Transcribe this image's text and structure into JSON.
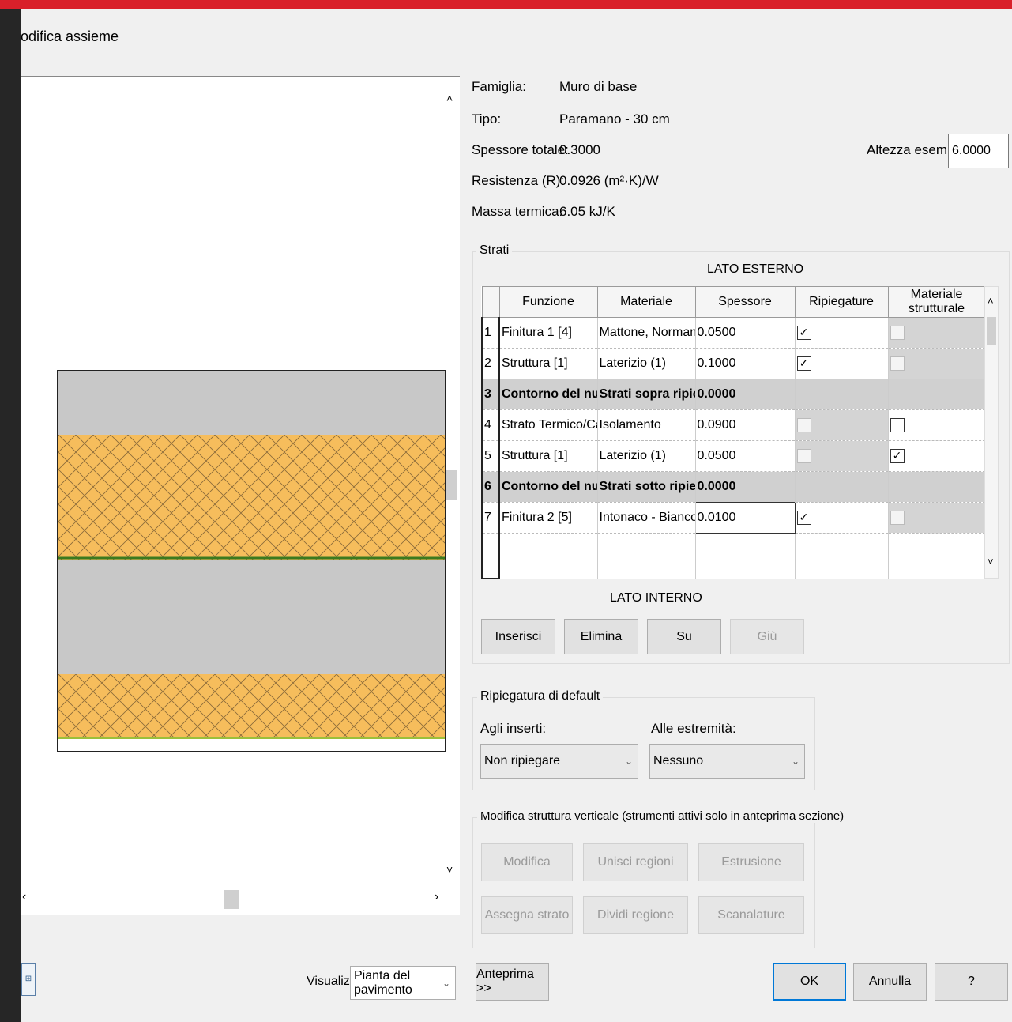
{
  "window": {
    "title": "odifica assieme"
  },
  "info": {
    "famiglia_label": "Famiglia:",
    "famiglia_value": "Muro di base",
    "tipo_label": "Tipo:",
    "tipo_value": "Paramano - 30 cm",
    "spessore_label": "Spessore totale:",
    "spessore_value": "0.3000",
    "resistenza_label": "Resistenza (R):",
    "resistenza_value": "0.0926 (m²·K)/W",
    "massa_label": "Massa termica:",
    "massa_value": "6.05 kJ/K",
    "altezza_label": "Altezza esempio:",
    "altezza_value": "6.0000"
  },
  "strati": {
    "group_label": "Strati",
    "lato_esterno": "LATO ESTERNO",
    "lato_interno": "LATO INTERNO",
    "columns": [
      "Funzione",
      "Materiale",
      "Spessore",
      "Ripiegature",
      "Materiale strutturale"
    ],
    "rows": [
      {
        "n": "1",
        "funzione": "Finitura 1 [4]",
        "materiale": "Mattone, Norman",
        "spessore": "0.0500",
        "rip": "checked",
        "strut": "disabled"
      },
      {
        "n": "2",
        "funzione": "Struttura [1]",
        "materiale": "Laterizio (1)",
        "spessore": "0.1000",
        "rip": "checked",
        "strut": "disabled"
      },
      {
        "n": "3",
        "funzione": "Contorno del nucleo",
        "materiale": "Strati sopra ripiegat",
        "spessore": "0.0000",
        "core": true
      },
      {
        "n": "4",
        "funzione": "Strato Termico/Came",
        "materiale": "Isolamento",
        "spessore": "0.0900",
        "rip": "disabled",
        "strut": "unchecked"
      },
      {
        "n": "5",
        "funzione": "Struttura [1]",
        "materiale": "Laterizio (1)",
        "spessore": "0.0500",
        "rip": "disabled",
        "strut": "checked"
      },
      {
        "n": "6",
        "funzione": "Contorno del nucleo",
        "materiale": "Strati sotto ripiegat",
        "spessore": "0.0000",
        "core": true
      },
      {
        "n": "7",
        "funzione": "Finitura 2 [5]",
        "materiale": "Intonaco - Bianco",
        "spessore": "0.0100",
        "rip": "checked",
        "strut": "disabled"
      }
    ],
    "buttons": {
      "inserisci": "Inserisci",
      "elimina": "Elimina",
      "su": "Su",
      "giu": "Giù"
    }
  },
  "ripiegatura": {
    "group_label": "Ripiegatura di default",
    "inserti_label": "Agli inserti:",
    "inserti_value": "Non ripiegare",
    "estremita_label": "Alle estremità:",
    "estremita_value": "Nessuno"
  },
  "verticale": {
    "group_label": "Modifica struttura verticale (strumenti attivi solo in anteprima sezione)",
    "modifica": "Modifica",
    "unisci": "Unisci regioni",
    "estrusione": "Estrusione",
    "assegna": "Assegna strato",
    "dividi": "Dividi regione",
    "scanalature": "Scanalature"
  },
  "footer": {
    "visualizza_label": "Visualizza:",
    "visualizza_value": "Pianta del pavimento",
    "anteprima": "Anteprima >>",
    "ok": "OK",
    "annulla": "Annulla",
    "help": "?"
  },
  "colors": {
    "accent_bar": "#d9202a",
    "insulation": "#f6bd5c",
    "masonry": "#c8c8c8"
  }
}
